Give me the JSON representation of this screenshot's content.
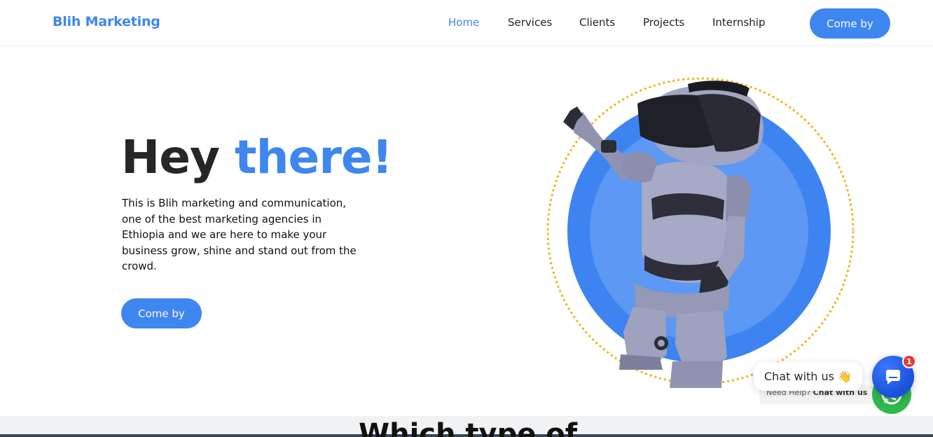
{
  "header": {
    "brand": "Blih Marketing",
    "nav": [
      {
        "label": "Home",
        "active": true
      },
      {
        "label": "Services",
        "active": false
      },
      {
        "label": "Clients",
        "active": false
      },
      {
        "label": "Projects",
        "active": false
      },
      {
        "label": "Internship",
        "active": false
      }
    ],
    "cta_label": "Come by"
  },
  "hero": {
    "title_part1": "Hey",
    "title_part2": "there!",
    "description": "This is Blih marketing and communication, one of the best marketing agencies in Ethiopia and we are here to make your business grow, shine and stand out from the crowd.",
    "cta_label": "Come by",
    "illustration_icon": "robot-vr-headset-illustration"
  },
  "next_section": {
    "heading": "Which type of"
  },
  "chat_widget": {
    "tooltip": "Chat with us",
    "tooltip_emoji": "👋",
    "need_help_prefix": "Need Help?",
    "need_help_link": "Chat with us",
    "badge_count": "1",
    "messenger_icon": "chat-bubble-icon",
    "whatsapp_icon": "whatsapp-icon"
  },
  "colors": {
    "accent": "#3f86ee",
    "circle_outer": "#3d84f1",
    "circle_inner": "#5c98f4",
    "dotted_ring": "#f2b417",
    "whatsapp": "#2fb84b",
    "messenger": "#1f57e0",
    "badge": "#e53935"
  }
}
